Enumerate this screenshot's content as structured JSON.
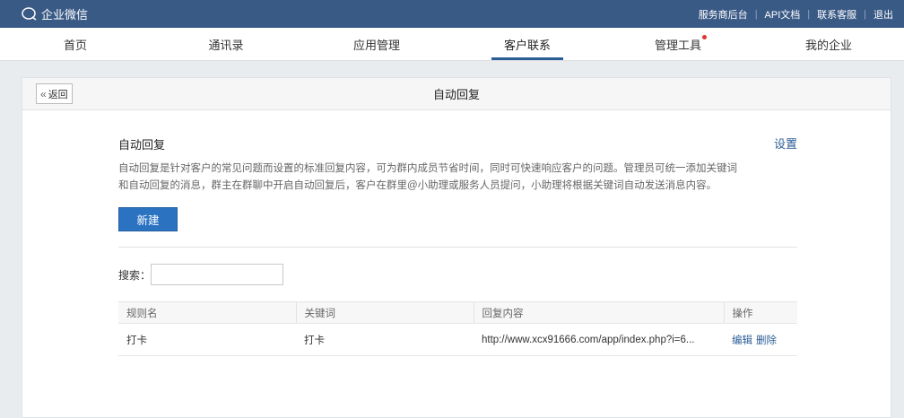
{
  "topbar": {
    "brand": "企业微信",
    "links": [
      "服务商后台",
      "API文档",
      "联系客服",
      "退出"
    ]
  },
  "nav": {
    "items": [
      {
        "label": "首页"
      },
      {
        "label": "通讯录"
      },
      {
        "label": "应用管理"
      },
      {
        "label": "客户联系"
      },
      {
        "label": "管理工具"
      },
      {
        "label": "我的企业"
      }
    ]
  },
  "page": {
    "back_label": "返回",
    "title": "自动回复",
    "section_title": "自动回复",
    "settings_label": "设置",
    "description_line1": "自动回复是针对客户的常见问题而设置的标准回复内容，可为群内成员节省时间，同时可快速响应客户的问题。管理员可统一添加关键词",
    "description_line2": "和自动回复的消息，群主在群聊中开启自动回复后，客户在群里@小助理或服务人员提问，小助理将根据关键词自动发送消息内容。",
    "new_button": "新建",
    "search_label": "搜索：",
    "search_value": ""
  },
  "table": {
    "headers": [
      "规则名",
      "关键词",
      "回复内容",
      "操作"
    ],
    "rows": [
      {
        "name": "打卡",
        "keyword": "打卡",
        "reply": "http://www.xcx91666.com/app/index.php?i=6...",
        "edit": "编辑",
        "delete": "删除"
      }
    ]
  },
  "colors": {
    "topbar": "#3a5a86",
    "accent": "#2b73c1",
    "nav_active": "#2b5d95",
    "notify_dot": "#e0352b"
  }
}
